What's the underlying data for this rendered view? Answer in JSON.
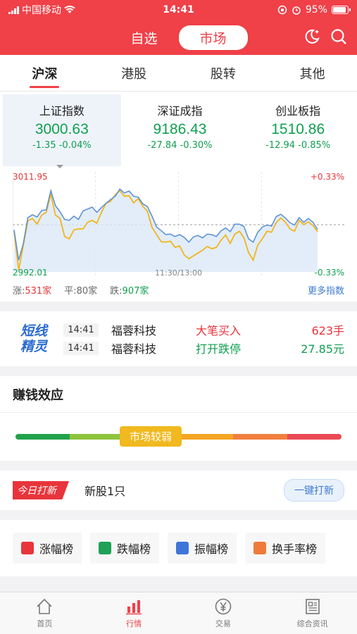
{
  "status": {
    "carrier": "中国移动",
    "time": "14:41",
    "battery": "95%"
  },
  "header": {
    "tabs": [
      "自选",
      "市场"
    ],
    "active_tab": "市场",
    "icons": [
      "night-mode-icon",
      "search-icon"
    ]
  },
  "subtabs": [
    "沪深",
    "港股",
    "股转",
    "其他"
  ],
  "indices": [
    {
      "name": "上证指数",
      "value": "3000.63",
      "change": "-1.35  -0.04%"
    },
    {
      "name": "深证成指",
      "value": "9186.43",
      "change": "-27.84  -0.30%"
    },
    {
      "name": "创业板指",
      "value": "1510.86",
      "change": "-12.94  -0.85%"
    }
  ],
  "chart_data": {
    "type": "line",
    "title": "",
    "x_mid_label": "11:30/13:00",
    "y_high": "3011.95",
    "y_low": "2992.01",
    "pct_high": "+0.33%",
    "pct_low": "-0.33%",
    "baseline": 3001.98,
    "series": [
      {
        "values": [
          3000.9,
          2994.5,
          2998,
          3003.5,
          3004.1,
          3003.6,
          3005,
          3005.1,
          3009.2,
          3006,
          3004.7,
          3003.1,
          3002.9,
          3003.8,
          3003.1,
          3004.9,
          3005.3,
          3005.7,
          3004.6,
          3005.6,
          3006.5,
          3007.3,
          3008,
          3009.5,
          3008.7,
          3009.1,
          3008,
          3007.8,
          3006.4,
          3005.8,
          3003.8,
          3001.5,
          3000.7,
          2999.9,
          3000,
          2999.5,
          2999.9,
          2999.3,
          2998.3,
          2999.4,
          2999.7,
          2999.2,
          3000,
          2999.9,
          2999.5,
          3000.7,
          3001.3,
          3000.5,
          3002.1,
          3002.1,
          3001.6,
          2999,
          2998.3,
          3000.4,
          3001.5,
          3001.9,
          3001.7,
          3003.7,
          3004.2,
          3003.4,
          3002.4,
          3001.9,
          3003.5,
          3002.5,
          3003.3,
          3002.5,
          3001
        ]
      },
      {
        "values": [
          3000.6,
          2992.4,
          2997.6,
          3002.8,
          3003.3,
          3002.1,
          3004,
          3004.6,
          3008.5,
          3004,
          3003.3,
          2999.5,
          2999,
          3000.9,
          3001.1,
          3001.1,
          3002.5,
          3002.9,
          3002.3,
          3004.6,
          3006.5,
          3006.9,
          3008.3,
          3009.2,
          3008,
          3008.1,
          3006.6,
          3007.5,
          3005.9,
          3004.8,
          3001.4,
          2999.9,
          2998.4,
          2998.3,
          2998.5,
          2997.2,
          2997.5,
          2995.6,
          2994.8,
          2995.4,
          2996,
          2996.6,
          2997.4,
          2996.9,
          2997.2,
          2998.7,
          2999.8,
          2998,
          3000,
          3000.6,
          2999.2,
          2996.1,
          2994.5,
          2997.7,
          2999,
          3000.6,
          3000.4,
          3002.4,
          3003.4,
          3002.5,
          3001.1,
          3000.6,
          3002.9,
          3002,
          3002.6,
          3001.8,
          3000.5
        ]
      }
    ],
    "ylim": [
      2992.01,
      3011.95
    ]
  },
  "breadth": {
    "up_label": "涨:",
    "up_count": "531家",
    "flat_label": "平:",
    "flat_count": "80家",
    "down_label": "跌:",
    "down_count": "907家",
    "more": "更多指数"
  },
  "sprite": {
    "logo_line1": "短线",
    "logo_line2": "精灵",
    "rows": [
      {
        "time": "14:41",
        "name": "福蓉科技",
        "action": "大笔买入",
        "value": "623手",
        "color": "#e8353b"
      },
      {
        "time": "14:41",
        "name": "福蓉科技",
        "action": "打开跌停",
        "value": "27.85元",
        "color": "#10a050"
      }
    ]
  },
  "money_effect": {
    "title": "赚钱效应",
    "badge": "市场较弱",
    "level": 0.4,
    "colors": [
      "#22a24a",
      "#8fc43d",
      "#c8d12e",
      "#f4a623",
      "#f17f3f",
      "#eb4a55"
    ]
  },
  "ipo": {
    "tag": "今日打新",
    "text": "新股1只",
    "button": "一键打新"
  },
  "ranks": [
    {
      "label": "涨幅榜",
      "color": "#e8353b",
      "icon": "rise-chart-icon"
    },
    {
      "label": "跌幅榜",
      "color": "#1fa256",
      "icon": "fall-chart-icon"
    },
    {
      "label": "振幅榜",
      "color": "#3f74d8",
      "icon": "amplitude-icon"
    },
    {
      "label": "换手率榜",
      "color": "#ef7a3a",
      "icon": "turnover-icon"
    }
  ],
  "tabbar": [
    {
      "label": "首页",
      "icon": "home-icon"
    },
    {
      "label": "行情",
      "icon": "market-chart-icon"
    },
    {
      "label": "交易",
      "icon": "yen-icon"
    },
    {
      "label": "综合资讯",
      "icon": "news-icon"
    }
  ]
}
